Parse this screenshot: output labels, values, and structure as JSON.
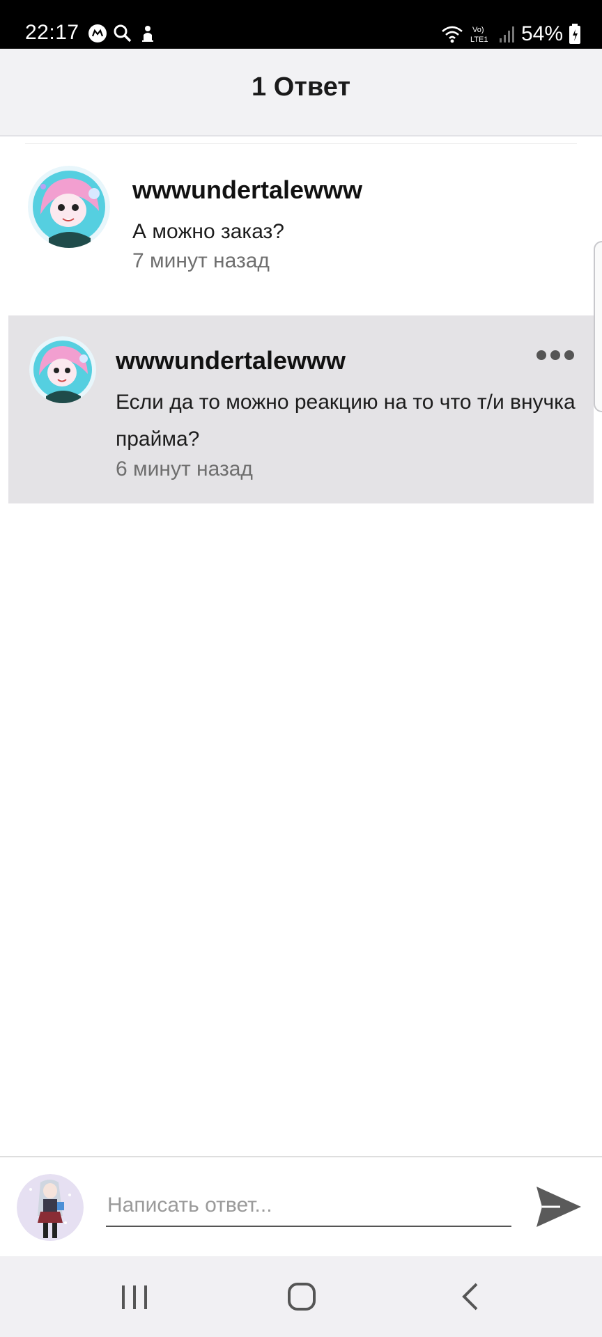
{
  "status_bar": {
    "time": "22:17",
    "left_icons": [
      "messenger-icon",
      "search-icon",
      "upload-icon"
    ],
    "right_icons": [
      "wifi-icon",
      "volte-lte-icon",
      "signal-icon",
      "battery-icon"
    ],
    "battery": "54%"
  },
  "header": {
    "title": "1 Ответ"
  },
  "comments": [
    {
      "username": "wwwundertalewww",
      "text": "А можно заказ?",
      "time": "7 минут назад",
      "highlighted": false
    },
    {
      "username": "wwwundertalewww",
      "text": "Если да то можно реакцию на то что т/и внучка прайма?",
      "time": "6 минут назад",
      "highlighted": true
    }
  ],
  "reply": {
    "placeholder": "Написать ответ...",
    "value": ""
  },
  "nav": {
    "icons": [
      "recents-icon",
      "home-icon",
      "back-icon"
    ]
  },
  "colors": {
    "status_bar": "#000000",
    "header_bg": "#f2f2f4",
    "highlight_bg": "#e4e3e6",
    "nav_bg": "#f1f0f3",
    "send_icon": "#5a5a5a"
  }
}
